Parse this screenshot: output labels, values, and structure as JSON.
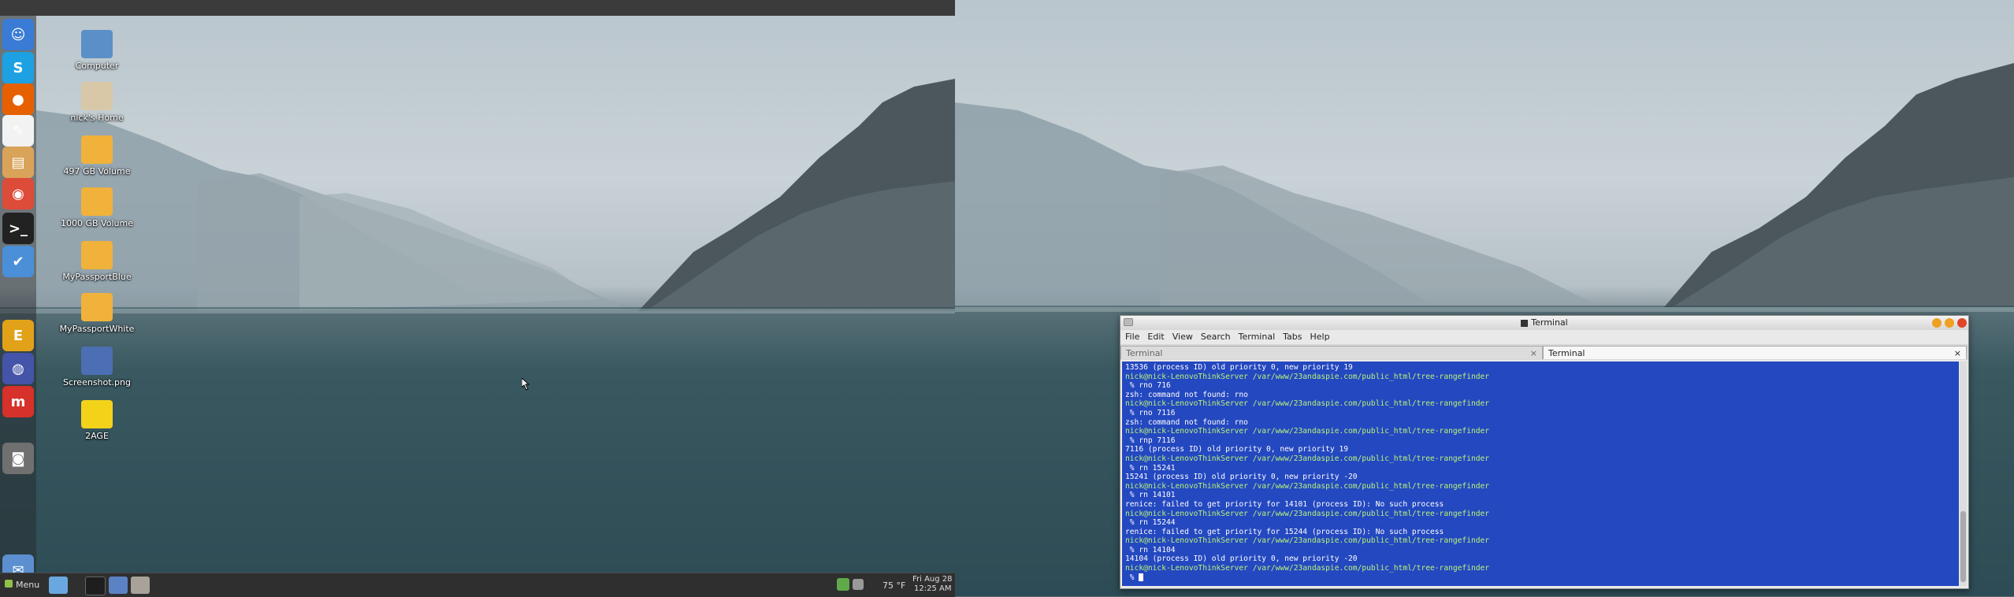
{
  "desktop_icons": [
    {
      "label": "Computer",
      "icon": "computer-icon",
      "color": "#5b8fc7"
    },
    {
      "label": "nick's Home",
      "icon": "home-folder-icon",
      "color": "#d8c8a8"
    },
    {
      "label": "497 GB Volume",
      "icon": "drive-icon",
      "color": "#f0b23a"
    },
    {
      "label": "1000 GB Volume",
      "icon": "drive-icon",
      "color": "#f0b23a"
    },
    {
      "label": "MyPassportBlue",
      "icon": "drive-icon",
      "color": "#f0b23a"
    },
    {
      "label": "MyPassportWhite",
      "icon": "drive-icon",
      "color": "#f0b23a"
    },
    {
      "label": "Screenshot.png",
      "icon": "image-file-icon",
      "color": "#4b6fb2"
    },
    {
      "label": "2AGE",
      "icon": "goggles-icon",
      "color": "#f3d21a"
    }
  ],
  "dock_items": [
    {
      "name": "finder-icon",
      "glyph": "☺",
      "color": "#3a7bd5"
    },
    {
      "name": "skype-icon",
      "glyph": "S",
      "color": "#1da1e2"
    },
    {
      "name": "firefox-icon",
      "glyph": "●",
      "color": "#e66000"
    },
    {
      "name": "text-editor-icon",
      "glyph": "✎",
      "color": "#f2f2f2"
    },
    {
      "name": "book-reader-icon",
      "glyph": "▤",
      "color": "#d9a35a"
    },
    {
      "name": "chrome-icon",
      "glyph": "◉",
      "color": "#dd4b39"
    },
    {
      "name": "terminal-icon",
      "glyph": ">_",
      "color": "#222222"
    },
    {
      "name": "settings-tool-icon",
      "glyph": "✔",
      "color": "#4a8fd8"
    },
    {
      "name": "e-app-icon",
      "glyph": "E",
      "color": "#e1a21a"
    },
    {
      "name": "globe-icon",
      "glyph": "◍",
      "color": "#4454a8"
    },
    {
      "name": "m-app-icon",
      "glyph": "m",
      "color": "#d6312a"
    },
    {
      "name": "screenshot-tool-icon",
      "glyph": "◙",
      "color": "#707070"
    },
    {
      "name": "mail-icon",
      "glyph": "✉",
      "color": "#5c8fd0"
    }
  ],
  "taskbar": {
    "menu_label": "Menu",
    "temperature": "75 °F",
    "date": "Fri Aug 28",
    "time": "12:25 AM"
  },
  "terminal": {
    "title": "Terminal",
    "menu": [
      "File",
      "Edit",
      "View",
      "Search",
      "Terminal",
      "Tabs",
      "Help"
    ],
    "tabs": [
      {
        "label": "Terminal",
        "active": false
      },
      {
        "label": "Terminal",
        "active": true
      }
    ],
    "close_glyph": "×",
    "lines": [
      {
        "t": "13536 (process ID) old priority 0, new priority 19"
      },
      {
        "p": "nick@nick-LenovoThinkServer",
        "d": " /var/www/23andaspie.com/public_html/tree-rangefinder"
      },
      {
        "t": " % rno 716"
      },
      {
        "t": "zsh: command not found: rno"
      },
      {
        "p": "nick@nick-LenovoThinkServer",
        "d": " /var/www/23andaspie.com/public_html/tree-rangefinder"
      },
      {
        "t": " % rno 7116"
      },
      {
        "t": "zsh: command not found: rno"
      },
      {
        "p": "nick@nick-LenovoThinkServer",
        "d": " /var/www/23andaspie.com/public_html/tree-rangefinder"
      },
      {
        "t": " % rnp 7116"
      },
      {
        "t": "7116 (process ID) old priority 0, new priority 19"
      },
      {
        "p": "nick@nick-LenovoThinkServer",
        "d": " /var/www/23andaspie.com/public_html/tree-rangefinder"
      },
      {
        "t": " % rn 15241"
      },
      {
        "t": "15241 (process ID) old priority 0, new priority -20"
      },
      {
        "p": "nick@nick-LenovoThinkServer",
        "d": " /var/www/23andaspie.com/public_html/tree-rangefinder"
      },
      {
        "t": " % rn 14101"
      },
      {
        "t": "renice: failed to get priority for 14101 (process ID): No such process"
      },
      {
        "p": "nick@nick-LenovoThinkServer",
        "d": " /var/www/23andaspie.com/public_html/tree-rangefinder"
      },
      {
        "t": " % rn 15244"
      },
      {
        "t": "renice: failed to get priority for 15244 (process ID): No such process"
      },
      {
        "p": "nick@nick-LenovoThinkServer",
        "d": " /var/www/23andaspie.com/public_html/tree-rangefinder"
      },
      {
        "t": " % rn 14104"
      },
      {
        "t": "14104 (process ID) old priority 0, new priority -20"
      },
      {
        "p": "nick@nick-LenovoThinkServer",
        "d": " /var/www/23andaspie.com/public_html/tree-rangefinder"
      },
      {
        "t": " % ",
        "cursor": true
      }
    ]
  }
}
